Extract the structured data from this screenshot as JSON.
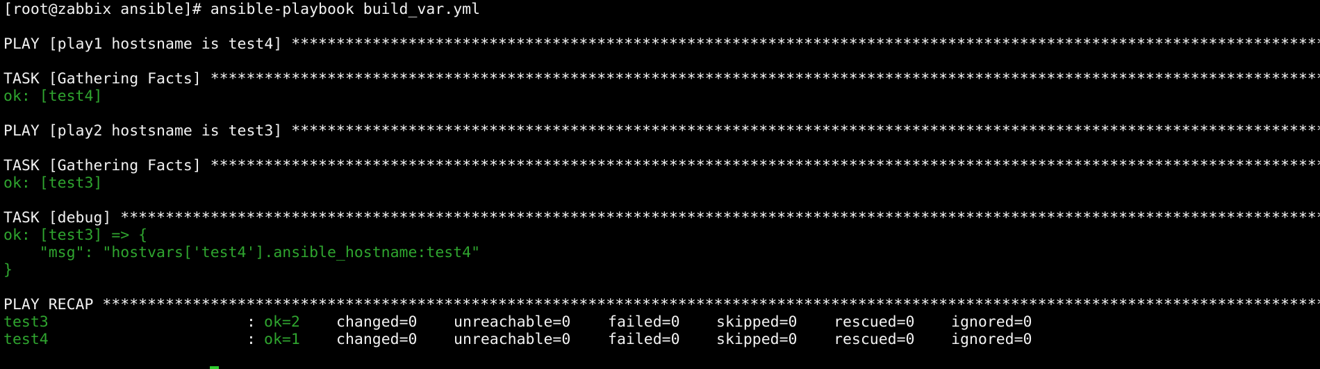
{
  "terminal": {
    "prompt": "[root@zabbix ansible]# ansible-playbook build_var.yml",
    "play1": "PLAY [play1 hostsname is test4] *******************************************************************************************************************",
    "task1": "TASK [Gathering Facts] **********************************************************************************************************************************",
    "ok1": "ok: [test4]",
    "play2": "PLAY [play2 hostsname is test3] *******************************************************************************************************************",
    "task2": "TASK [Gathering Facts] **********************************************************************************************************************************",
    "ok2": "ok: [test3]",
    "task3": "TASK [debug] **************************************************************************************************************************************************",
    "ok3": "ok: [test3] => {",
    "msg": "    \"msg\": \"hostvars['test4'].ansible_hostname:test4\"",
    "close_brace": "}",
    "recap": "PLAY RECAP **************************************************************************************************************************************************",
    "recap_rows": [
      {
        "host": "test3",
        "colon": ":",
        "ok": "ok=2",
        "changed": "changed=0",
        "unreachable": "unreachable=0",
        "failed": "failed=0",
        "skipped": "skipped=0",
        "rescued": "rescued=0",
        "ignored": "ignored=0"
      },
      {
        "host": "test4",
        "colon": ":",
        "ok": "ok=1",
        "changed": "changed=0",
        "unreachable": "unreachable=0",
        "failed": "failed=0",
        "skipped": "skipped=0",
        "rescued": "rescued=0",
        "ignored": "ignored=0"
      }
    ],
    "colors": {
      "background": "#000000",
      "foreground": "#f2f2f2",
      "ok_green": "#2fa52f",
      "cursor": "#2ecc2e"
    }
  }
}
